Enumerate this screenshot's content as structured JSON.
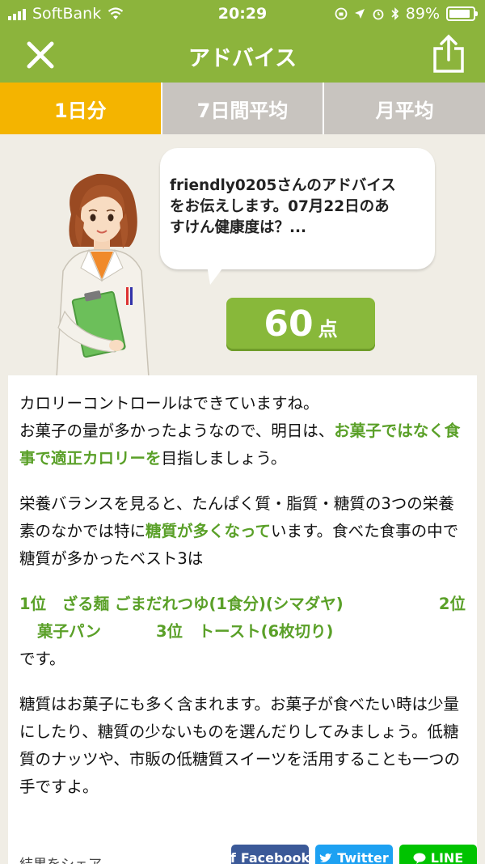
{
  "status_bar": {
    "carrier": "SoftBank",
    "time": "20:29",
    "battery": "89%",
    "battery_level": 0.89
  },
  "header": {
    "title": "アドバイス"
  },
  "tabs": [
    {
      "label": "1日分",
      "active": true
    },
    {
      "label": "7日間平均",
      "active": false
    },
    {
      "label": "月平均",
      "active": false
    }
  ],
  "bubble": {
    "line1": "friendly0205さんのアドバイス",
    "line2": "をお伝えします。07月22日のあ",
    "line3": "すけん健康度は？..."
  },
  "score": {
    "value": "60",
    "unit": "点"
  },
  "advice": {
    "p1_a": "カロリーコントロールはできていますね。",
    "p1_b": "お菓子の量が多かったようなので、明日は、",
    "p1_hl": "お菓子ではなく食事で適正カロリーを",
    "p1_c": "目指しましょう。",
    "p2_a": "栄養バランスを見ると、たんぱく質・脂質・糖質の3つの栄養素のなかでは特に",
    "p2_hl": "糖質が多くなって",
    "p2_b": "います。食べた食事の中で糖質が多かったベスト3は",
    "rank1": "1位　ざる麺 ごまだれつゆ(1食分)(シマダヤ)",
    "rank2_pos": "2位",
    "rank2": "菓子パン",
    "rank3": "3位　トースト(6枚切り)",
    "desu": "です。",
    "p3": "糖質はお菓子にも多く含まれます。お菓子が食べたい時は少量にしたり、糖質の少ないものを選んだりしてみましょう。低糖質のナッツや、市販の低糖質スイーツを活用することも一つの手ですよ。"
  },
  "share": {
    "label": "結果をシェア",
    "facebook": "Facebook",
    "twitter": "Twitter",
    "line": "LINE"
  },
  "colors": {
    "header_green": "#8cb43c",
    "tab_active": "#f4b400",
    "tab_inactive": "#c8c4bf",
    "highlight_green": "#5aa028",
    "score_green": "#88b83a"
  }
}
